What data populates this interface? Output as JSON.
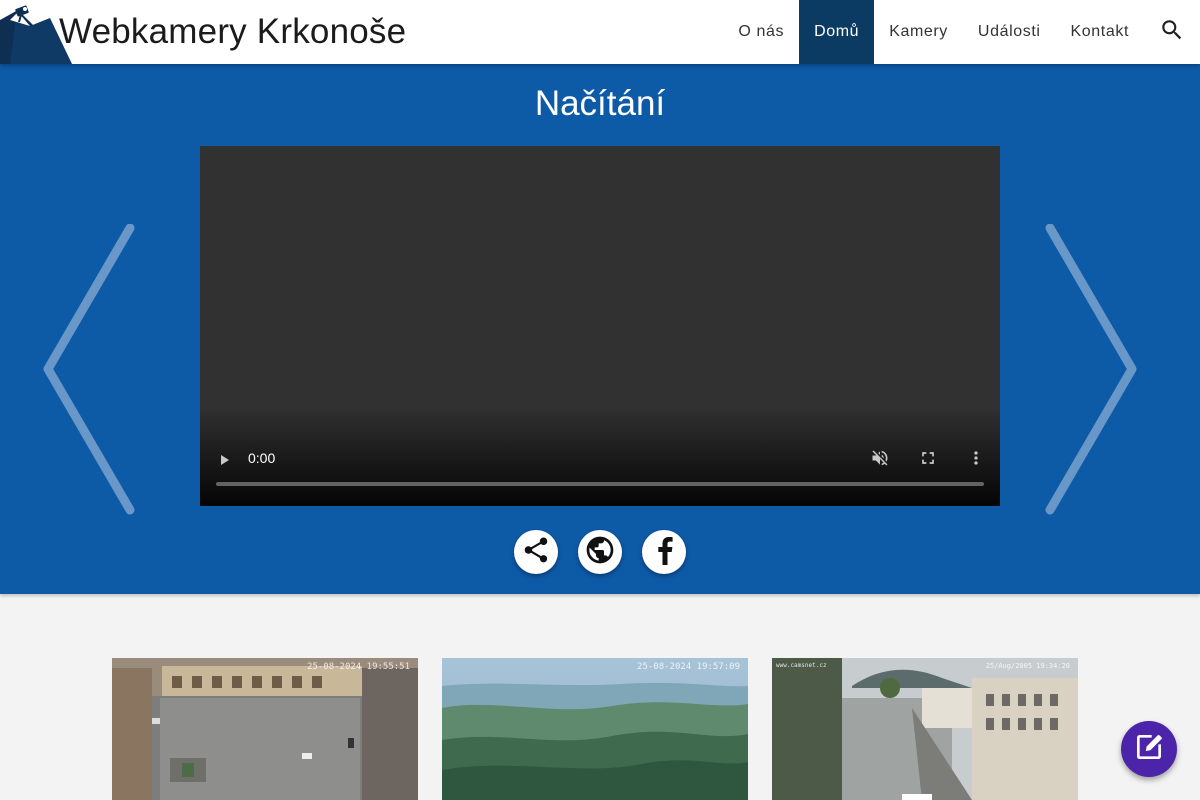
{
  "header": {
    "title": "Webkamery Krkonoše",
    "nav": [
      {
        "label": "O nás"
      },
      {
        "label": "Domů",
        "active": true
      },
      {
        "label": "Kamery"
      },
      {
        "label": "Události"
      },
      {
        "label": "Kontakt"
      }
    ],
    "search_icon": "search-icon"
  },
  "hero": {
    "title": "Načítání",
    "video": {
      "time": "0:00",
      "controls": [
        "play-icon",
        "mute-icon",
        "fullscreen-icon",
        "more-vert-icon"
      ]
    },
    "share_buttons": [
      "share-icon",
      "globe-icon",
      "facebook-icon"
    ]
  },
  "thumbnails": [
    {
      "stamp": "25-08-2024 19:55:51"
    },
    {
      "stamp": "25-08-2024 19:57:09"
    },
    {
      "stamp": "25/Aug/2005 19:34:20",
      "site": "www.camsnet.cz"
    }
  ],
  "colors": {
    "hero_bg": "#0d5aa7",
    "nav_active": "#0b3a63",
    "fab": "#4b24a9"
  }
}
